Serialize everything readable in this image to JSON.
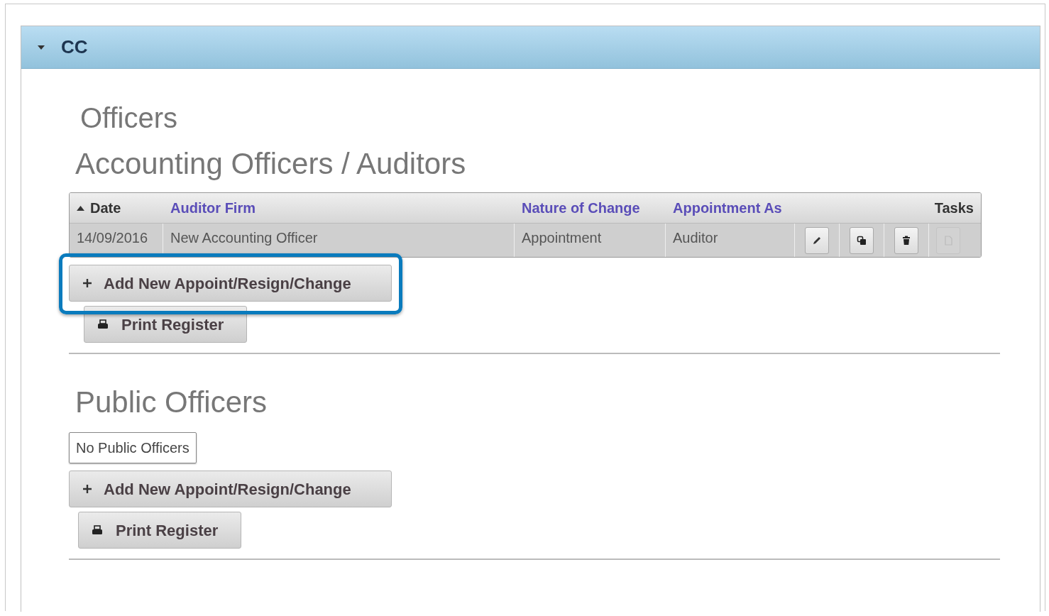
{
  "panel": {
    "title": "CC",
    "expanded": true
  },
  "page_title": "Officers",
  "sections": [
    {
      "heading": "Accounting Officers / Auditors",
      "kind": "table",
      "table": {
        "columns": [
          {
            "label": "Date",
            "sortable": false,
            "sorted": true
          },
          {
            "label": "Auditor Firm",
            "sortable": true,
            "sorted": false
          },
          {
            "label": "Nature of Change",
            "sortable": true,
            "sorted": false
          },
          {
            "label": "Appointment As",
            "sortable": true,
            "sorted": false
          },
          {
            "label": "Tasks",
            "sortable": false,
            "sorted": false
          }
        ],
        "rows": [
          {
            "cells": [
              "14/09/2016",
              "New Accounting Officer",
              "Appointment",
              "Auditor"
            ],
            "tasks": [
              {
                "kind": "edit",
                "disabled": false
              },
              {
                "kind": "copy",
                "disabled": false
              },
              {
                "kind": "delete",
                "disabled": false
              },
              {
                "kind": "document",
                "disabled": true
              }
            ]
          }
        ]
      },
      "add_button": {
        "label": "Add New Appoint/Resign/Change",
        "highlighted": true
      },
      "print_button": {
        "label": "Print Register"
      }
    },
    {
      "heading": "Public Officers",
      "kind": "empty",
      "empty_text": "No Public Officers",
      "add_button": {
        "label": "Add New Appoint/Resign/Change",
        "highlighted": false
      },
      "print_button": {
        "label": "Print Register"
      }
    }
  ]
}
